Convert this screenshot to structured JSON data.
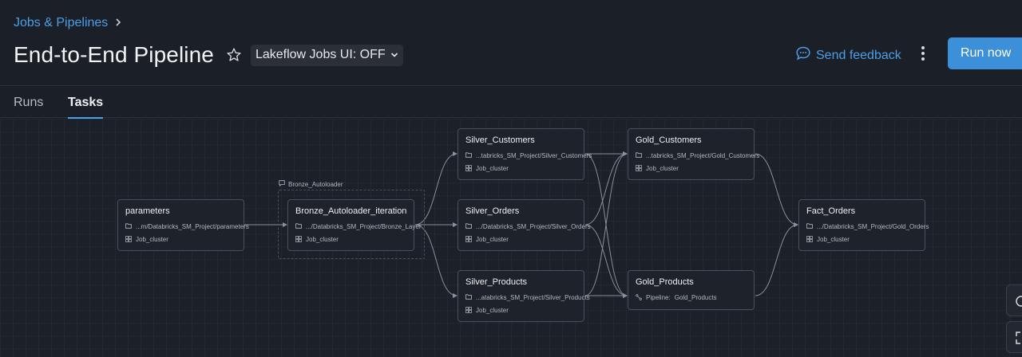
{
  "breadcrumb": {
    "label": "Jobs & Pipelines"
  },
  "header": {
    "title": "End-to-End Pipeline",
    "ui_toggle": "Lakeflow Jobs UI: OFF",
    "feedback": "Send feedback",
    "run_now": "Run now"
  },
  "tabs": [
    {
      "label": "Runs",
      "active": false
    },
    {
      "label": "Tasks",
      "active": true
    }
  ],
  "group": {
    "label": "Bronze_Autoloader"
  },
  "nodes": {
    "parameters": {
      "title": "parameters",
      "path": "...m/Databricks_SM_Project/parameters",
      "cluster": "Job_cluster"
    },
    "bronze": {
      "title": "Bronze_Autoloader_iteration",
      "path": ".../Databricks_SM_Project/Bronze_Layer",
      "cluster": "Job_cluster"
    },
    "silver_customers": {
      "title": "Silver_Customers",
      "path": "...tabricks_SM_Project/Silver_Customers",
      "cluster": "Job_cluster"
    },
    "silver_orders": {
      "title": "Silver_Orders",
      "path": ".../Databricks_SM_Project/Silver_Orders",
      "cluster": "Job_cluster"
    },
    "silver_products": {
      "title": "Silver_Products",
      "path": "...atabricks_SM_Project/Silver_Products",
      "cluster": "Job_cluster"
    },
    "gold_customers": {
      "title": "Gold_Customers",
      "path": "...tabricks_SM_Project/Gold_Customers",
      "cluster": "Job_cluster"
    },
    "gold_products": {
      "title": "Gold_Products",
      "pipeline_label": "Pipeline:",
      "pipeline_name": "Gold_Products"
    },
    "fact_orders": {
      "title": "Fact_Orders",
      "path": ".../Databricks_SM_Project/Gold_Orders",
      "cluster": "Job_cluster"
    }
  },
  "colors": {
    "accent": "#4a9fe8",
    "run_button": "#3c8fd9",
    "background": "#1b1f27",
    "node_border": "#4a5059",
    "edge": "#8a9099"
  },
  "icons": [
    "chevron-right-icon",
    "star-icon",
    "chevron-down-icon",
    "chat-bubble-icon",
    "kebab-icon",
    "folder-icon",
    "cluster-icon",
    "pipeline-icon",
    "comment-icon"
  ]
}
